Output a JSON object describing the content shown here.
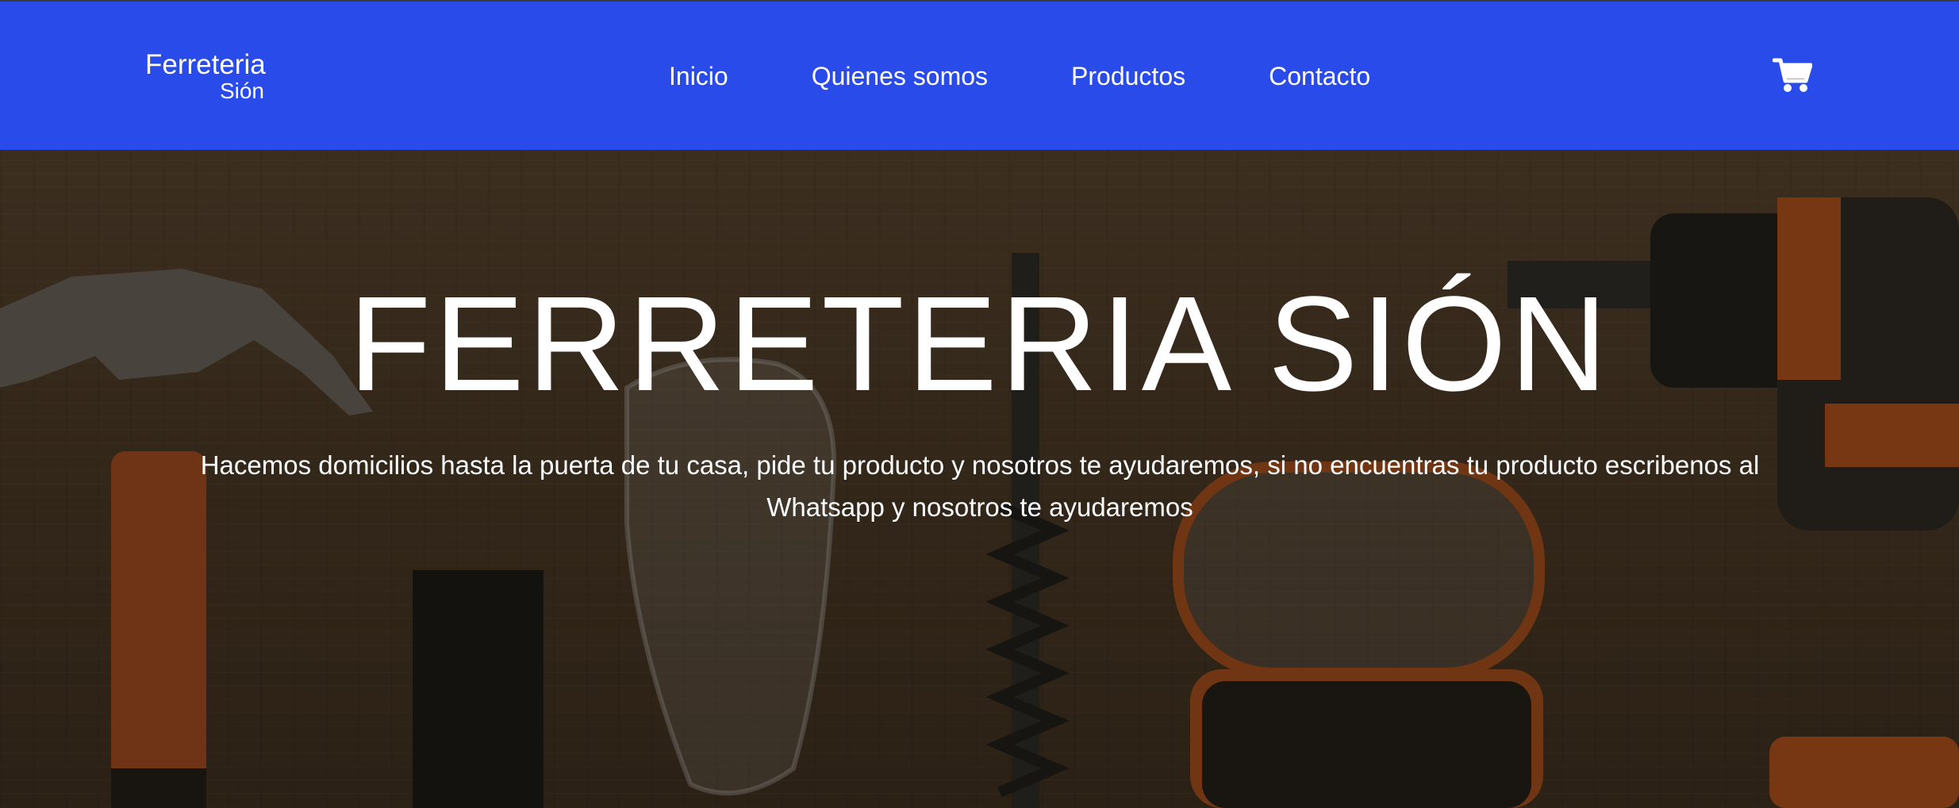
{
  "brand": {
    "line1": "Ferreteria",
    "line2": "Sión"
  },
  "nav": {
    "items": [
      {
        "label": "Inicio"
      },
      {
        "label": "Quienes somos"
      },
      {
        "label": "Productos"
      },
      {
        "label": "Contacto"
      }
    ],
    "cart_icon": "shopping-cart-icon"
  },
  "hero": {
    "title": "FERRETERIA SIÓN",
    "subtitle": "Hacemos domicilios hasta la puerta de tu casa, pide tu producto y nosotros te ayudaremos, si no encuentras tu producto escribenos al Whatsapp y nosotros te ayudaremos"
  },
  "colors": {
    "navbar": "#284be9",
    "text": "#ffffff",
    "hero_wood": "#4b3a28"
  }
}
